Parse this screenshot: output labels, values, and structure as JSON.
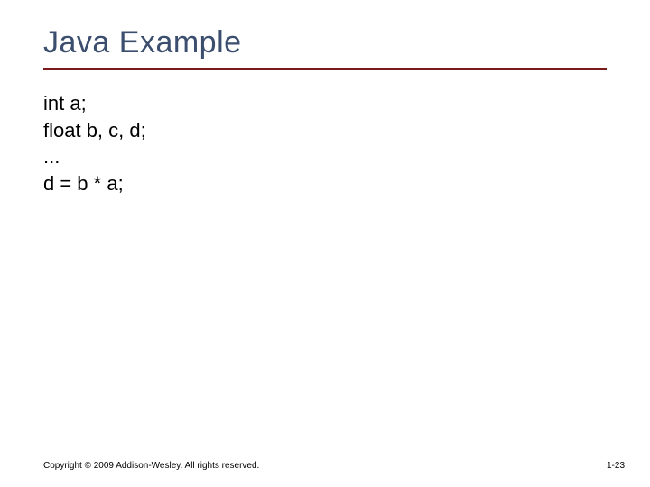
{
  "title": "Java Example",
  "code": {
    "line1": "int a;",
    "line2": "float b, c, d;",
    "line3": "...",
    "line4": "d = b * a;"
  },
  "footer": {
    "copyright": "Copyright © 2009 Addison-Wesley. All rights reserved.",
    "page": "1-23"
  }
}
